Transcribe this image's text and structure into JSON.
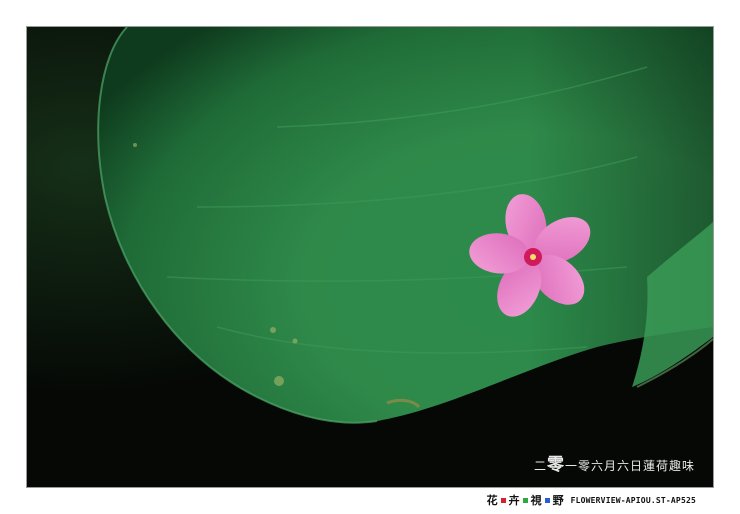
{
  "photo": {
    "subject": "lotus-leaf-with-pink-flower",
    "caption_first_char": "二",
    "caption_big_char": "零",
    "caption_rest": "一零六月六日蓮荷趣味"
  },
  "footer": {
    "chars": [
      "花",
      "卉",
      "視",
      "野"
    ],
    "square_colors": [
      "#d9202a",
      "#2fa83c",
      "#2a5bd8"
    ],
    "site": "FLOWERVIEW-APIOU.ST-AP525"
  },
  "colors": {
    "background": "#050805",
    "leaf": "#2f8a4a",
    "petal": "#e77fc7",
    "flower_center": "#d11a5b"
  }
}
